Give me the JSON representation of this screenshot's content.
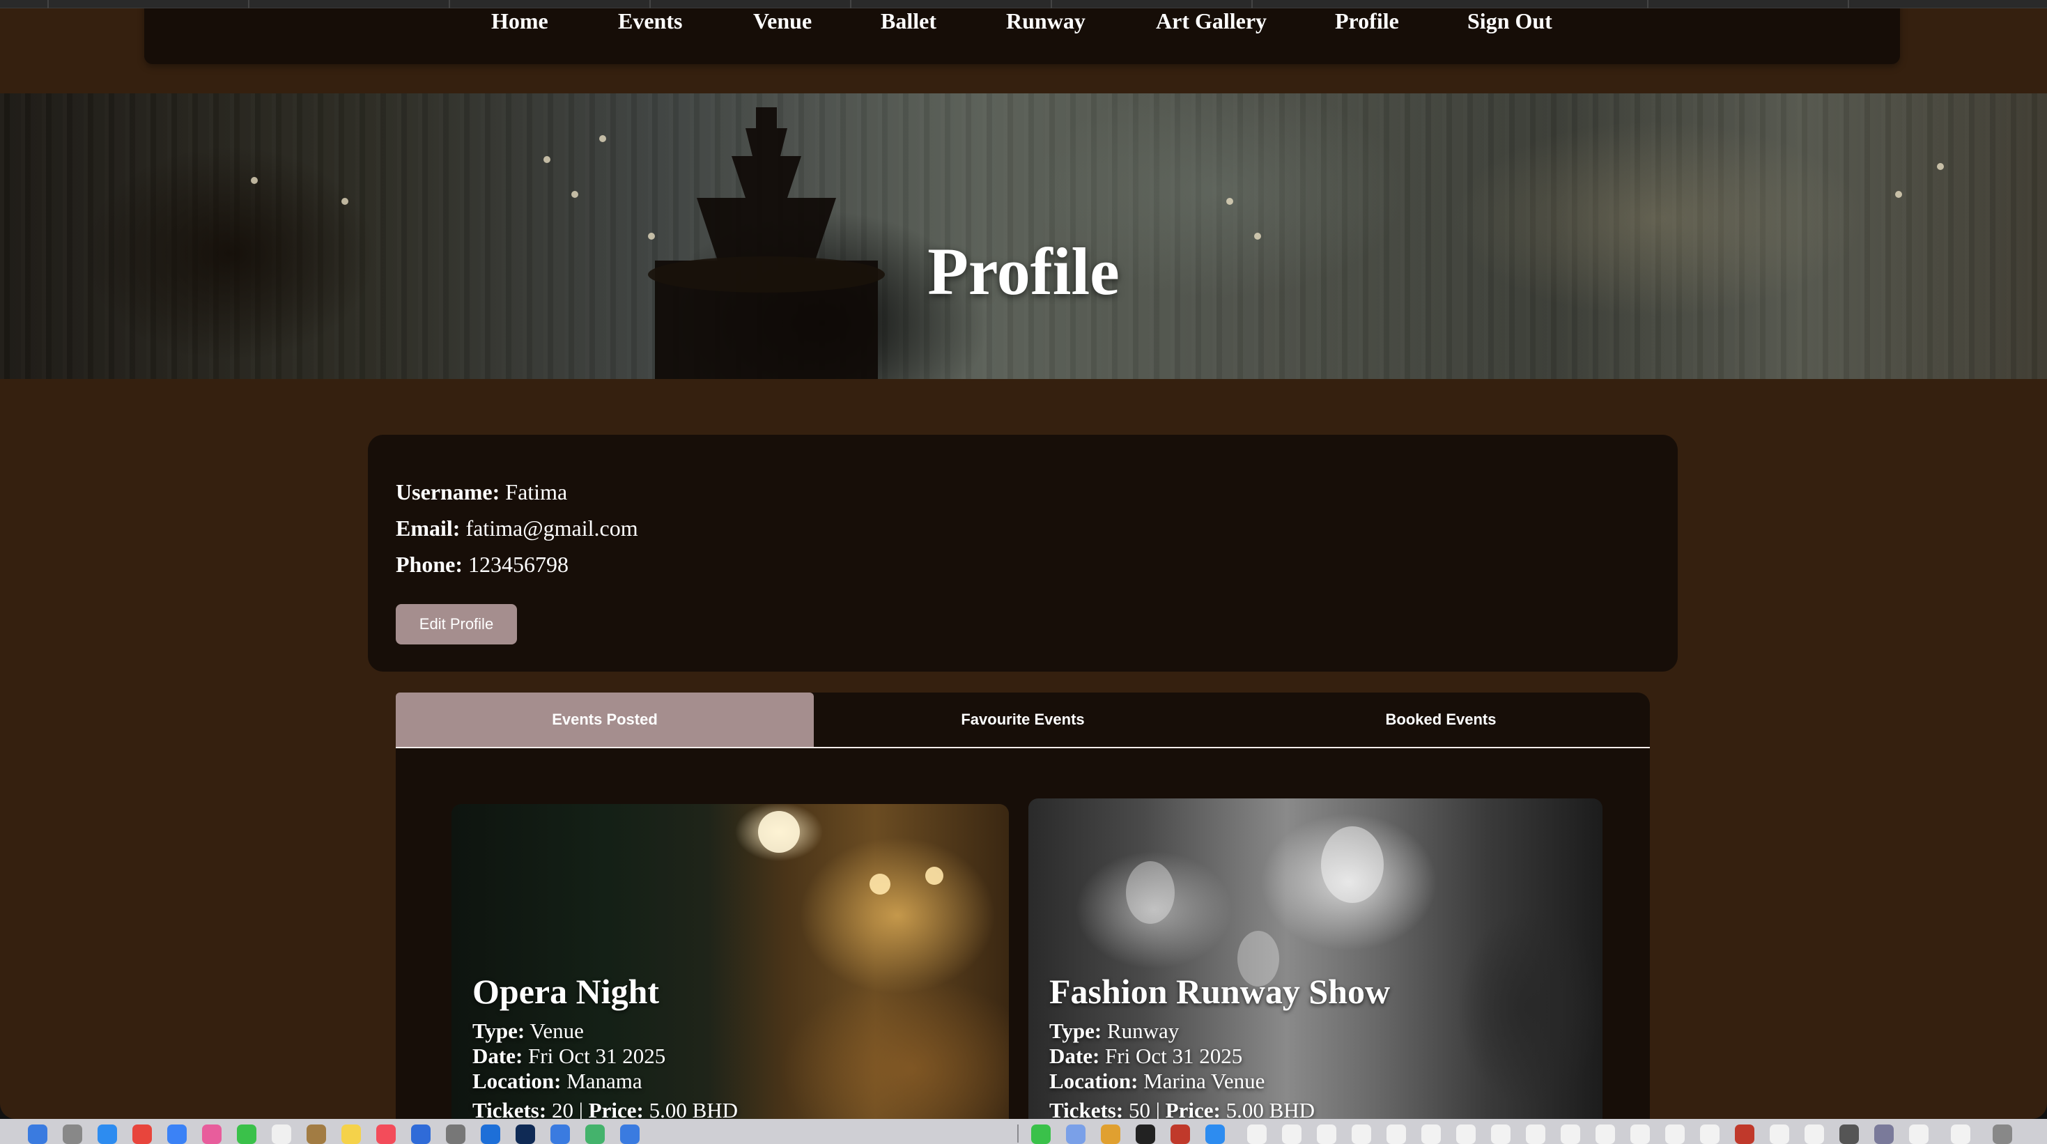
{
  "nav": {
    "items": [
      "Home",
      "Events",
      "Venue",
      "Ballet",
      "Runway",
      "Art Gallery",
      "Profile",
      "Sign Out"
    ]
  },
  "hero": {
    "title": "Profile"
  },
  "profile": {
    "username_label": "Username:",
    "username": "Fatima",
    "email_label": "Email:",
    "email": "fatima@gmail.com",
    "phone_label": "Phone:",
    "phone": "123456798",
    "edit_button": "Edit Profile"
  },
  "tabs": {
    "items": [
      "Events Posted",
      "Favourite Events",
      "Booked Events"
    ],
    "active": "Events Posted"
  },
  "events": [
    {
      "title": "Opera Night",
      "type_label": "Type:",
      "type": "Venue",
      "date_label": "Date:",
      "date": "Fri Oct 31 2025",
      "location_label": "Location:",
      "location": "Manama",
      "tickets_label": "Tickets:",
      "tickets": "20",
      "separator": " | ",
      "price_label": "Price:",
      "price": "5.00 BHD"
    },
    {
      "title": "Fashion Runway Show",
      "type_label": "Type:",
      "type": "Runway",
      "date_label": "Date:",
      "date": "Fri Oct 31 2025",
      "location_label": "Location:",
      "location": "Marina Venue",
      "tickets_label": "Tickets:",
      "tickets": "50",
      "separator": " | ",
      "price_label": "Price:",
      "price": "5.00 BHD"
    }
  ],
  "colors": {
    "page_bg": "#35200f",
    "card_bg": "#170e08",
    "accent": "#a58e8e",
    "text": "#ffffff"
  }
}
